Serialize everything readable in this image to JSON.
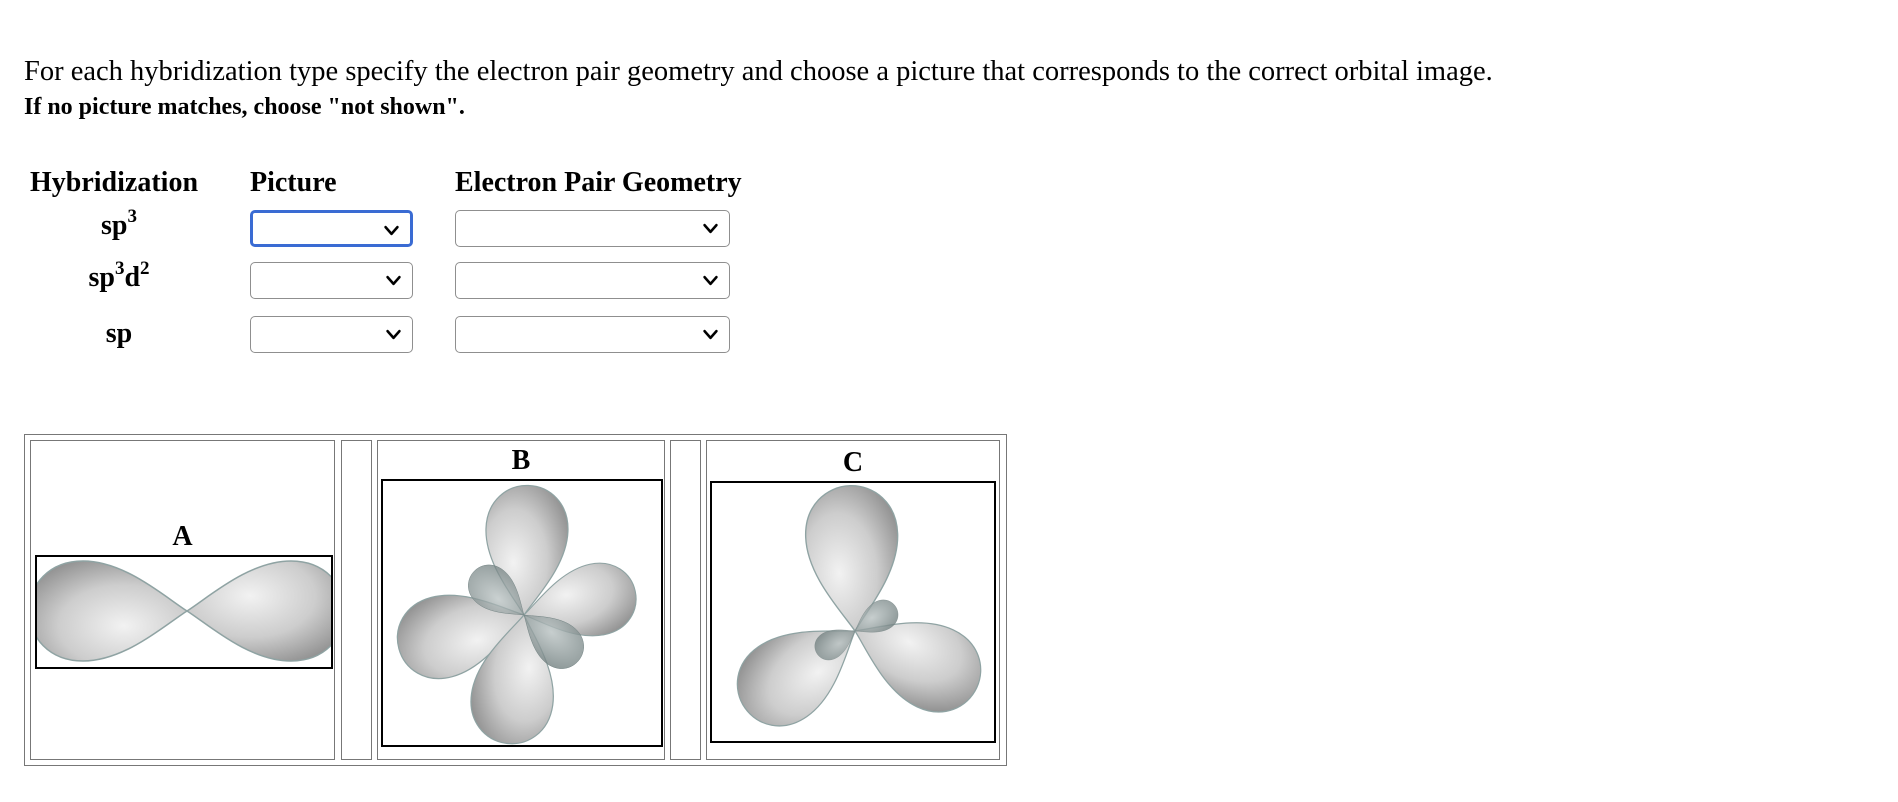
{
  "instructions": {
    "line1": "For each hybridization type specify the electron pair geometry and choose a picture that corresponds to the correct orbital image.",
    "line2": "If no picture matches, choose \"not shown\"."
  },
  "table": {
    "headers": {
      "hybridization": "Hybridization",
      "picture": "Picture",
      "geometry": "Electron Pair Geometry"
    },
    "rows": [
      {
        "base": "sp",
        "sup1": "3",
        "mid": "",
        "sup2": "",
        "picture_value": "",
        "geometry_value": ""
      },
      {
        "base": "sp",
        "sup1": "3",
        "mid": "d",
        "sup2": "2",
        "picture_value": "",
        "geometry_value": ""
      },
      {
        "base": "sp",
        "sup1": "",
        "mid": "",
        "sup2": "",
        "picture_value": "",
        "geometry_value": ""
      }
    ]
  },
  "images": {
    "a_label": "A",
    "b_label": "B",
    "c_label": "C"
  },
  "colors": {
    "focus_ring": "#3a6bd3",
    "orbital_fill": "#c8c8c8",
    "orbital_edge": "#8fa3a3"
  }
}
